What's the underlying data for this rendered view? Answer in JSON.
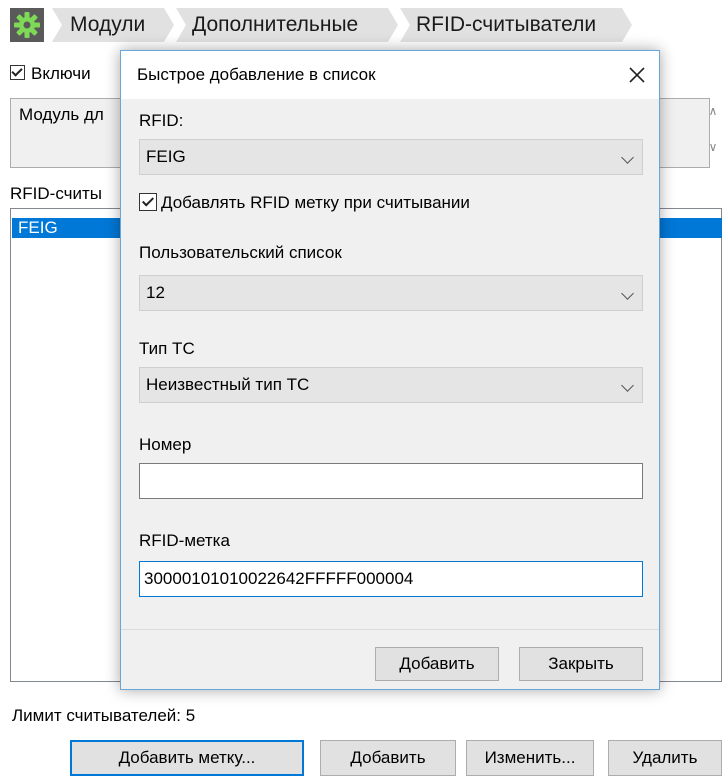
{
  "breadcrumb": {
    "items": [
      "Модули",
      "Дополнительные",
      "RFID-считыватели"
    ]
  },
  "background": {
    "enable_checkbox_label": "Включи",
    "module_text": "Модуль дл",
    "readers_label": "RFID-считы",
    "readers_list": [
      "FEIG"
    ],
    "limit_label": "Лимит считывателей:",
    "limit_value": "5",
    "buttons": {
      "add_tag": "Добавить метку...",
      "add": "Добавить",
      "edit": "Изменить...",
      "delete": "Удалить"
    }
  },
  "dialog": {
    "title": "Быстрое добавление в список",
    "rfid_label": "RFID:",
    "rfid_value": "FEIG",
    "add_on_read_label": "Добавлять RFID метку при считывании",
    "add_on_read_checked": true,
    "user_list_label": "Пользовательский список",
    "user_list_value": "12",
    "vehicle_type_label": "Тип ТС",
    "vehicle_type_value": "Неизвестный тип ТС",
    "number_label": "Номер",
    "number_value": "",
    "rfid_tag_label": "RFID-метка",
    "rfid_tag_value": "30000101010022642FFFFF000004",
    "add_button": "Добавить",
    "close_button": "Закрыть"
  },
  "colors": {
    "accent": "#0078d7",
    "selection": "#0078d7",
    "dialog_bg": "#f0f0f0",
    "button_bg": "#e1e1e1"
  }
}
